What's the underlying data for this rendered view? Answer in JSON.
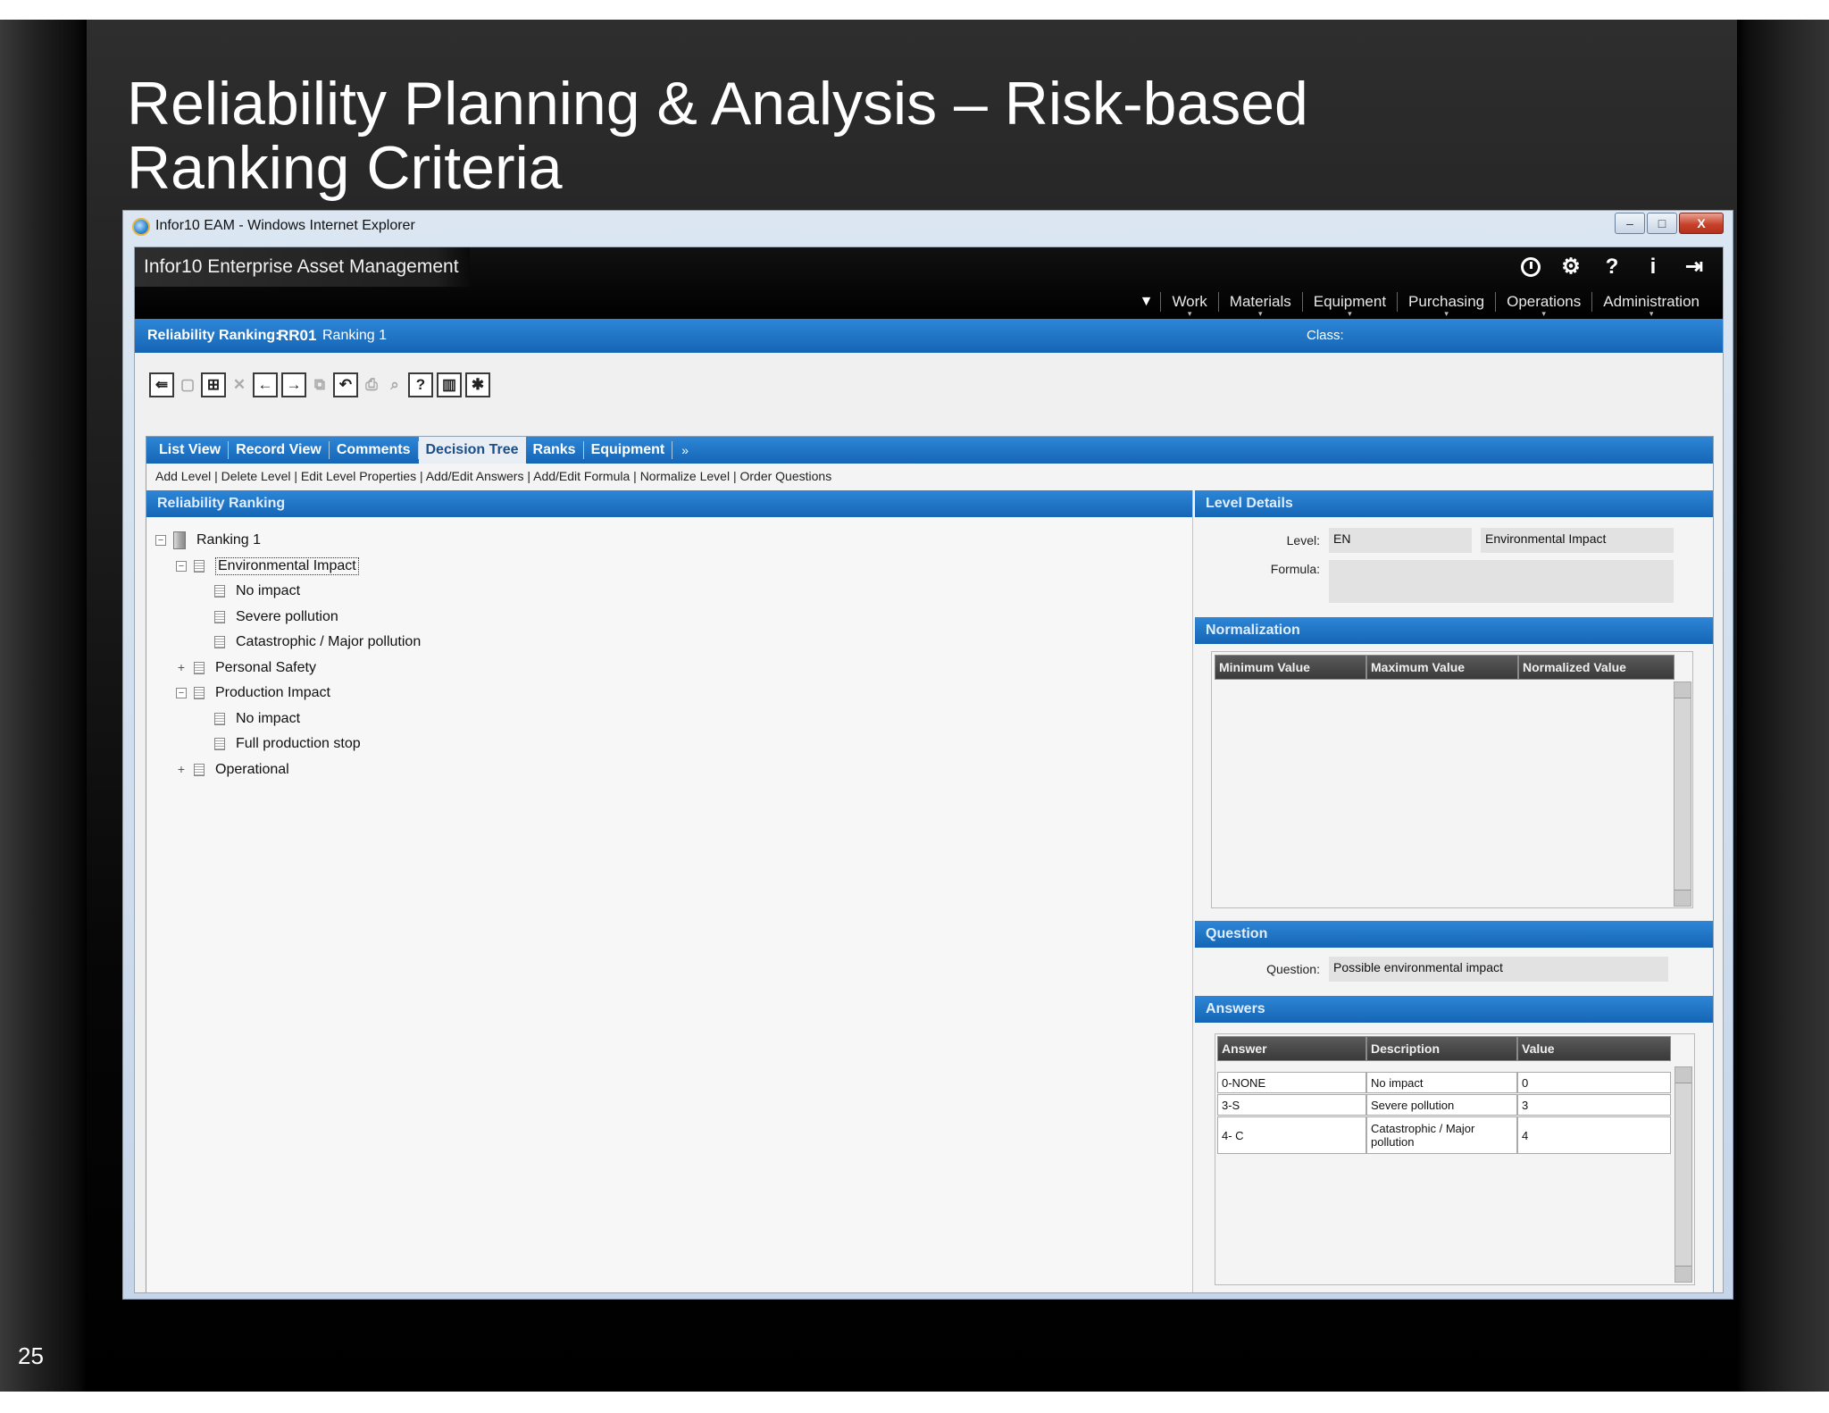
{
  "slide": {
    "title_line1": "Reliability Planning & Analysis – Risk-based",
    "title_line2": "Ranking Criteria",
    "page_number": "25"
  },
  "window": {
    "title": "Infor10 EAM - Windows Internet Explorer",
    "controls": [
      "–",
      "□",
      "X"
    ]
  },
  "app": {
    "name": "Infor10  Enterprise Asset Management",
    "header_icons": [
      "clock-icon",
      "gear-icon",
      "help-icon",
      "info-icon",
      "logout-icon"
    ],
    "nav": [
      "Work",
      "Materials",
      "Equipment",
      "Purchasing",
      "Operations",
      "Administration"
    ]
  },
  "record": {
    "label": "Reliability Ranking:",
    "code": "RR01",
    "description": "Ranking 1",
    "class_label": "Class:"
  },
  "toolbar": {
    "buttons": [
      "back-icon",
      "save-icon",
      "new-record-icon",
      "delete-icon",
      "previous-icon",
      "next-icon",
      "copy-icon",
      "undo-icon",
      "print-icon",
      "preview-icon",
      "help-icon",
      "book-icon",
      "pin-icon"
    ]
  },
  "tabs": {
    "items": [
      "List View",
      "Record View",
      "Comments",
      "Decision Tree",
      "Ranks",
      "Equipment"
    ],
    "active": "Decision Tree",
    "more": "»"
  },
  "subactions": "Add Level | Delete Level | Edit Level Properties | Add/Edit Answers | Add/Edit Formula | Normalize Level | Order Questions",
  "left_panel": {
    "title": "Reliability Ranking",
    "tree": {
      "root": "Ranking 1",
      "n1": "Environmental Impact",
      "n1a": "No impact",
      "n1b": "Severe pollution",
      "n1c": "Catastrophic / Major pollution",
      "n2": "Personal Safety",
      "n3": "Production Impact",
      "n3a": "No impact",
      "n3b": "Full production stop",
      "n4": "Operational"
    }
  },
  "level_details": {
    "title": "Level Details",
    "level_label": "Level:",
    "level_code": "EN",
    "level_desc": "Environmental Impact",
    "formula_label": "Formula:",
    "formula_value": ""
  },
  "normalization": {
    "title": "Normalization",
    "columns": [
      "Minimum Value",
      "Maximum Value",
      "Normalized Value"
    ]
  },
  "question": {
    "title": "Question",
    "label": "Question:",
    "value": "Possible environmental impact"
  },
  "answers": {
    "title": "Answers",
    "columns": [
      "Answer",
      "Description",
      "Value"
    ],
    "rows": [
      {
        "answer": "0-NONE",
        "description": "No impact",
        "value": "0"
      },
      {
        "answer": "3-S",
        "description": "Severe pollution",
        "value": "3"
      },
      {
        "answer": "4- C",
        "description": "Catastrophic / Major pollution",
        "value": "4"
      }
    ]
  }
}
